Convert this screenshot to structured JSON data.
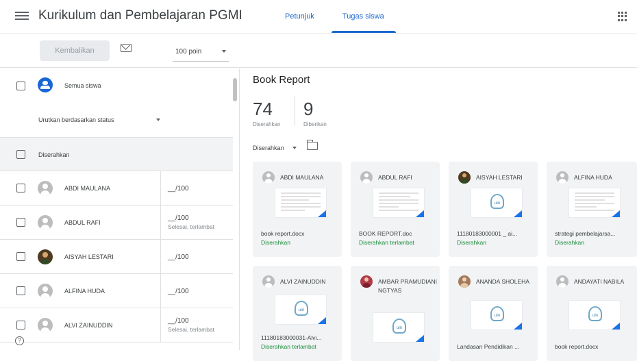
{
  "app": {
    "title": "Kurikulum dan Pembelajaran PGMI",
    "tabs": [
      {
        "label": "Petunjuk",
        "active": false
      },
      {
        "label": "Tugas siswa",
        "active": true
      }
    ],
    "accent_color": "#1967d2"
  },
  "toolbar": {
    "return_label": "Kembalikan",
    "points_value": "100 poin"
  },
  "left": {
    "all_students_label": "Semua siswa",
    "sort_label": "Urutkan berdasarkan status",
    "group_label": "Diserahkan",
    "students": [
      {
        "name": "ABDI MAULANA",
        "grade": "__/100",
        "note": ""
      },
      {
        "name": "ABDUL RAFI",
        "grade": "__/100",
        "note": "Selesai, terlambat"
      },
      {
        "name": "AISYAH LESTARI",
        "grade": "__/100",
        "note": ""
      },
      {
        "name": "ALFINA HUDA",
        "grade": "__/100",
        "note": ""
      },
      {
        "name": "ALVI ZAINUDDIN",
        "grade": "__/100",
        "note": "Selesai, terlambat"
      }
    ]
  },
  "right": {
    "assignment_title": "Book Report",
    "stats": [
      {
        "value": "74",
        "label": "Diserahkan"
      },
      {
        "value": "9",
        "label": "Diberikan"
      }
    ],
    "filter_label": "Diserahkan",
    "cards": [
      {
        "name": "ABDI MAULANA",
        "file": "book report.docx",
        "status": "Diserahkan"
      },
      {
        "name": "ABDUL RAFI",
        "file": "BOOK REPORT.doc",
        "status": "Diserahkan terlambat"
      },
      {
        "name": "AISYAH LESTARI",
        "file": "11180183000001 _ ai...",
        "status": "Diserahkan"
      },
      {
        "name": "ALFINA HUDA",
        "file": "strategi pembelajarsa...",
        "status": "Diserahkan"
      },
      {
        "name": "ALVI ZAINUDDIN",
        "file": "11180183000031-Alvi...",
        "status": "Diserahkan terlambat"
      },
      {
        "name": "AMBAR PRAMUDIANINGTYAS",
        "file": "",
        "status": ""
      },
      {
        "name": "ANANDA SHOLEHA",
        "file": "Landasan Pendidikan ...",
        "status": ""
      },
      {
        "name": "ANDAYATI NABILA",
        "file": "book report.docx",
        "status": ""
      }
    ]
  },
  "icons": {
    "menu": "hamburger-icon",
    "apps": "apps-grid-icon",
    "email": "mail-icon",
    "folder": "folder-icon",
    "help": "help-icon"
  }
}
